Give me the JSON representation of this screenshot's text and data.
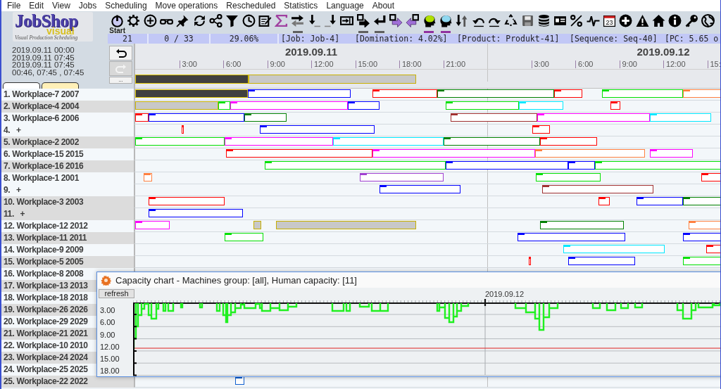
{
  "menu": [
    "File",
    "Edit",
    "View",
    "Jobs",
    "Scheduling",
    "Move operations",
    "Rescheduled",
    "Statistics",
    "Language",
    "About"
  ],
  "logo": {
    "title": "JobShop",
    "subtitle": "visual",
    "tagline": "Visual Production Scheduling"
  },
  "toolbar": {
    "buttons": [
      {
        "label": "Start",
        "indicator": false
      },
      {
        "indicator": false
      },
      {
        "indicator": false
      },
      {
        "indicator": false
      },
      {
        "indicator": false
      },
      {
        "indicator": false
      },
      {
        "indicator": false
      },
      {
        "indicator": false
      },
      {
        "indicator": false
      },
      {
        "indicator": false
      },
      {
        "indicator": false
      },
      {
        "indicator": true,
        "color": "#606060"
      },
      {
        "indicator": false
      },
      {
        "indicator": false
      },
      {
        "indicator": false
      },
      {
        "indicator": true,
        "color": "#606060"
      },
      {
        "indicator": true,
        "color": "#606060"
      },
      {
        "indicator": false
      },
      {
        "indicator": false
      },
      {
        "indicator": true,
        "color": "#9030a0"
      },
      {
        "indicator": true,
        "color": "#9030a0"
      },
      {
        "indicator": false
      },
      {
        "indicator": false
      },
      {
        "indicator": false
      },
      {
        "indicator": false
      },
      {
        "indicator": false
      },
      {
        "indicator": false
      },
      {
        "indicator": false
      },
      {
        "indicator": false
      },
      {
        "indicator": false
      },
      {
        "label": "23",
        "indicator": false
      },
      {
        "indicator": false
      },
      {
        "indicator": false
      },
      {
        "indicator": false
      },
      {
        "indicator": false
      },
      {
        "indicator": false
      },
      {
        "indicator": false
      }
    ]
  },
  "status": [
    "21",
    "0 / 33",
    "29.06%",
    "[Job: Job-4]",
    "[Domination: 4.02%]",
    "[Product: Produkt-41]",
    "[Sequence: Seq-40]",
    "[PC: 5.65 o"
  ],
  "left_panel": {
    "lines": [
      "2019.09.11 00:00",
      "2019.09.11 07:45",
      "2019.09.11 07:45",
      "00:46, 07:45 , 07:45"
    ],
    "buttons": [
      {
        "kind": "undo",
        "disabled": false
      },
      {
        "kind": "redo",
        "disabled": true
      },
      {
        "kind": "more",
        "label": "...",
        "disabled": false
      }
    ],
    "tabs": [
      {
        "selected": false
      },
      {
        "selected": true
      }
    ]
  },
  "timeline": {
    "days": [
      {
        "label": "2019.09.11",
        "hours": [
          "3:00",
          "6:00",
          "9:00",
          "12:00",
          "15:00",
          "18:00",
          "21:00"
        ]
      },
      {
        "label": "2019.09.12",
        "hours": [
          "3:00",
          "6:00",
          "9:00",
          "12:00",
          "15:"
        ]
      }
    ],
    "overview": [
      {
        "kind": "active"
      },
      {
        "kind": "job"
      }
    ]
  },
  "rows": [
    {
      "label": "1. Workplace-7 2007",
      "shaded": false,
      "bars": [
        {
          "kind": "active"
        },
        {
          "kind": "op",
          "color": "#0000ff"
        },
        {
          "kind": "op",
          "color": "#ff0000"
        },
        {
          "kind": "op",
          "color": "#008000"
        },
        {
          "kind": "op",
          "color": "#ff0000"
        },
        {
          "kind": "op",
          "color": "#00e000"
        },
        {
          "kind": "op",
          "color": "#ff8040"
        }
      ]
    },
    {
      "label": "2. Workplace-4 2004",
      "shaded": true,
      "bars": [
        {
          "kind": "job"
        },
        {
          "kind": "op",
          "color": "#00e000"
        },
        {
          "kind": "op",
          "color": "#ff00ff"
        },
        {
          "kind": "op",
          "color": "#0000ff"
        },
        {
          "kind": "op",
          "color": "#00e000"
        },
        {
          "kind": "op",
          "color": "#00e8ff"
        },
        {
          "kind": "op",
          "color": "#ff0000"
        }
      ]
    },
    {
      "label": "3. Workplace-6 2006",
      "shaded": false,
      "bars": [
        {
          "kind": "op",
          "color": "#ff0000"
        },
        {
          "kind": "op",
          "color": "#0000ff"
        },
        {
          "kind": "op",
          "color": "#008000"
        },
        {
          "kind": "op",
          "color": "#a03030"
        },
        {
          "kind": "op",
          "color": "#ff00ff"
        },
        {
          "kind": "op",
          "color": "#00e8ff"
        }
      ]
    },
    {
      "label": "4.   +",
      "shaded": false,
      "bars": [
        {
          "kind": "op",
          "color": "#ff0000"
        },
        {
          "kind": "op",
          "color": "#0000ff"
        },
        {
          "kind": "op",
          "color": "#ff0000"
        }
      ]
    },
    {
      "label": "5. Workplace-2 2002",
      "shaded": true,
      "bars": [
        {
          "kind": "op",
          "color": "#00e000"
        },
        {
          "kind": "op",
          "color": "#ff00ff"
        },
        {
          "kind": "op",
          "color": "#00e8ff"
        },
        {
          "kind": "op",
          "color": "#008000"
        },
        {
          "kind": "op",
          "color": "#ff0000"
        }
      ]
    },
    {
      "label": "6. Workplace-15 2015",
      "shaded": false,
      "bars": [
        {
          "kind": "op",
          "color": "#ff0000"
        },
        {
          "kind": "op",
          "color": "#ff00ff"
        },
        {
          "kind": "op",
          "color": "#ff8040"
        },
        {
          "kind": "op",
          "color": "#ff00ff"
        }
      ]
    },
    {
      "label": "7. Workplace-16 2016",
      "shaded": true,
      "bars": [
        {
          "kind": "op",
          "color": "#00e000"
        },
        {
          "kind": "op",
          "color": "#0000ff"
        },
        {
          "kind": "op",
          "color": "#0000ff"
        },
        {
          "kind": "op",
          "color": "#00e000"
        }
      ]
    },
    {
      "label": "8. Workplace-1 2001",
      "shaded": false,
      "bars": [
        {
          "kind": "op",
          "color": "#ff8040"
        },
        {
          "kind": "op",
          "color": "#a040d0"
        },
        {
          "kind": "op",
          "color": "#00e000"
        },
        {
          "kind": "op",
          "color": "#ff0000"
        }
      ]
    },
    {
      "label": "9.   +",
      "shaded": false,
      "bars": [
        {
          "kind": "op",
          "color": "#0000ff"
        },
        {
          "kind": "op",
          "color": "#a03030"
        }
      ]
    },
    {
      "label": "10. Workplace-3 2003",
      "shaded": true,
      "bars": [
        {
          "kind": "op",
          "color": "#ff0000"
        },
        {
          "kind": "op",
          "color": "#ff0000"
        },
        {
          "kind": "op",
          "color": "#0000ff"
        },
        {
          "kind": "op",
          "color": "#008000"
        }
      ]
    },
    {
      "label": "11.   +",
      "shaded": true,
      "bars": [
        {
          "kind": "op",
          "color": "#0000ff"
        }
      ]
    },
    {
      "label": "12. Workplace-12 2012",
      "shaded": false,
      "bars": [
        {
          "kind": "op",
          "color": "#ff00ff"
        },
        {
          "kind": "job"
        },
        {
          "kind": "job"
        },
        {
          "kind": "op",
          "color": "#008000"
        },
        {
          "kind": "op",
          "color": "#ff8040"
        }
      ]
    },
    {
      "label": "13. Workplace-11 2011",
      "shaded": true,
      "bars": [
        {
          "kind": "op",
          "color": "#00e000"
        },
        {
          "kind": "op",
          "color": "#0000ff"
        },
        {
          "kind": "op",
          "color": "#0000ff"
        }
      ]
    },
    {
      "label": "14. Workplace-9 2009",
      "shaded": false,
      "bars": [
        {
          "kind": "op",
          "color": "#00e8ff"
        },
        {
          "kind": "op",
          "color": "#ff0000"
        }
      ]
    },
    {
      "label": "15. Workplace-5 2005",
      "shaded": true,
      "bars": [
        {
          "kind": "op",
          "color": "#ff0000"
        },
        {
          "kind": "op",
          "color": "#0000ff"
        },
        {
          "kind": "op",
          "color": "#00e000"
        }
      ]
    },
    {
      "label": "16. Workplace-8 2008",
      "shaded": false
    },
    {
      "label": "17. Workplace-13 2013",
      "shaded": true
    },
    {
      "label": "18. Workplace-18 2018",
      "shaded": false
    },
    {
      "label": "19. Workplace-26 2026",
      "shaded": true
    },
    {
      "label": "20. Workplace-29 2029",
      "shaded": false
    },
    {
      "label": "21. Workplace-21 2021",
      "shaded": true
    },
    {
      "label": "22. Workplace-10 2010",
      "shaded": false
    },
    {
      "label": "23. Workplace-24 2024",
      "shaded": true
    },
    {
      "label": "24. Workplace-25 2025",
      "shaded": false
    },
    {
      "label": "25. Workplace-22 2022",
      "shaded": true,
      "bars": [
        {
          "kind": "op",
          "color": "#1060d0"
        }
      ]
    }
  ],
  "capacity_chart": {
    "title": "Capacity chart - Machines group: [all], Human capacity: [11]",
    "refresh_label": "refresh",
    "date_label": "2019.09.12",
    "y_labels": [
      "3.00",
      "6.00",
      "9.00",
      "12.00",
      "15.00",
      "18.00"
    ]
  }
}
